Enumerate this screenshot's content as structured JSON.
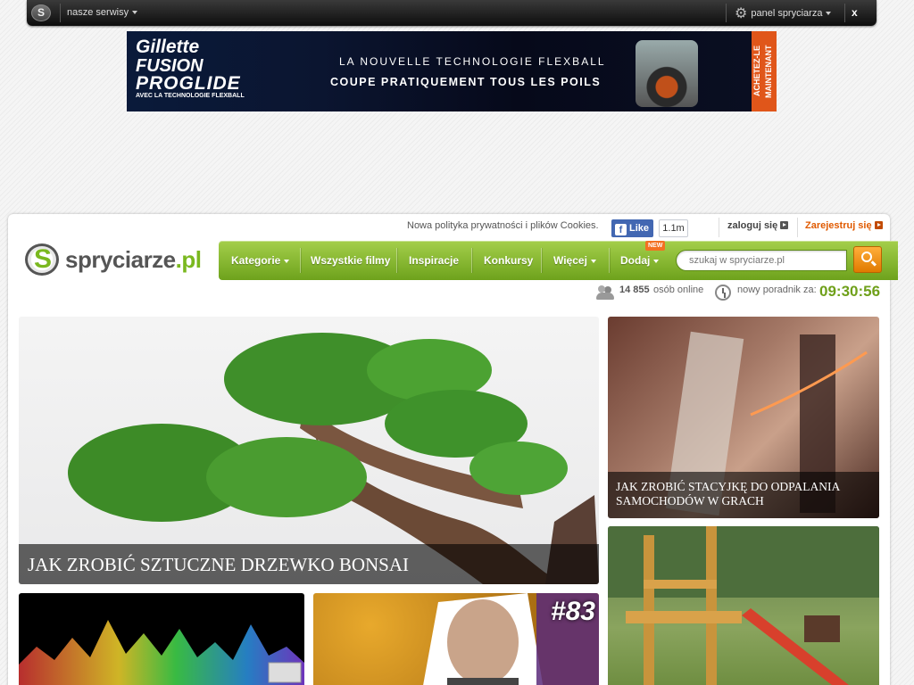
{
  "topbar": {
    "services_label": "nasze serwisy",
    "panel_label": "panel spryciarza",
    "close_label": "x"
  },
  "ad": {
    "brand_line1": "Gillette",
    "brand_line2": "FUSION",
    "brand_line3": "PROGLIDE",
    "brand_line4": "AVEC LA TECHNOLOGIE FLEXBALL",
    "headline1": "LA NOUVELLE TECHNOLOGIE FLEXBALL",
    "headline2": "COUPE PRATIQUEMENT TOUS LES POILS",
    "cta": "ACHETEZ-LE MAINTENANT"
  },
  "header": {
    "cookies_notice": "Nowa polityka prywatności i plików Cookies.",
    "fb_like_label": "Like",
    "fb_like_count": "1.1m",
    "login_label": "zaloguj się",
    "register_label": "Zarejestruj się"
  },
  "logo": {
    "name_main": "spryciarze",
    "name_tld": ".pl"
  },
  "nav": {
    "items": [
      {
        "label": "Kategorie"
      },
      {
        "label": "Wszystkie filmy"
      },
      {
        "label": "Inspiracje"
      },
      {
        "label": "Konkursy"
      },
      {
        "label": "Więcej"
      },
      {
        "label": "Dodaj"
      }
    ],
    "new_badge": "NEW",
    "search_placeholder": "szukaj w spryciarze.pl"
  },
  "stats": {
    "online_count": "14 855",
    "online_label": "osób online",
    "next_label": "nowy poradnik za:",
    "timer": "09:30:56"
  },
  "tiles": [
    {
      "title": "JAK ZROBIĆ SZTUCZNE DRZEWKO BONSAI"
    },
    {
      "title": "JAK ZROBIĆ STACYJKĘ DO ODPALANIA SAMOCHODÓW W GRACH"
    },
    {
      "title": ""
    },
    {
      "tag": "#83"
    },
    {
      "title": ""
    }
  ],
  "colors": {
    "accent_green": "#7ab81f",
    "register_orange": "#e05a00",
    "search_button": "#f08c00"
  }
}
